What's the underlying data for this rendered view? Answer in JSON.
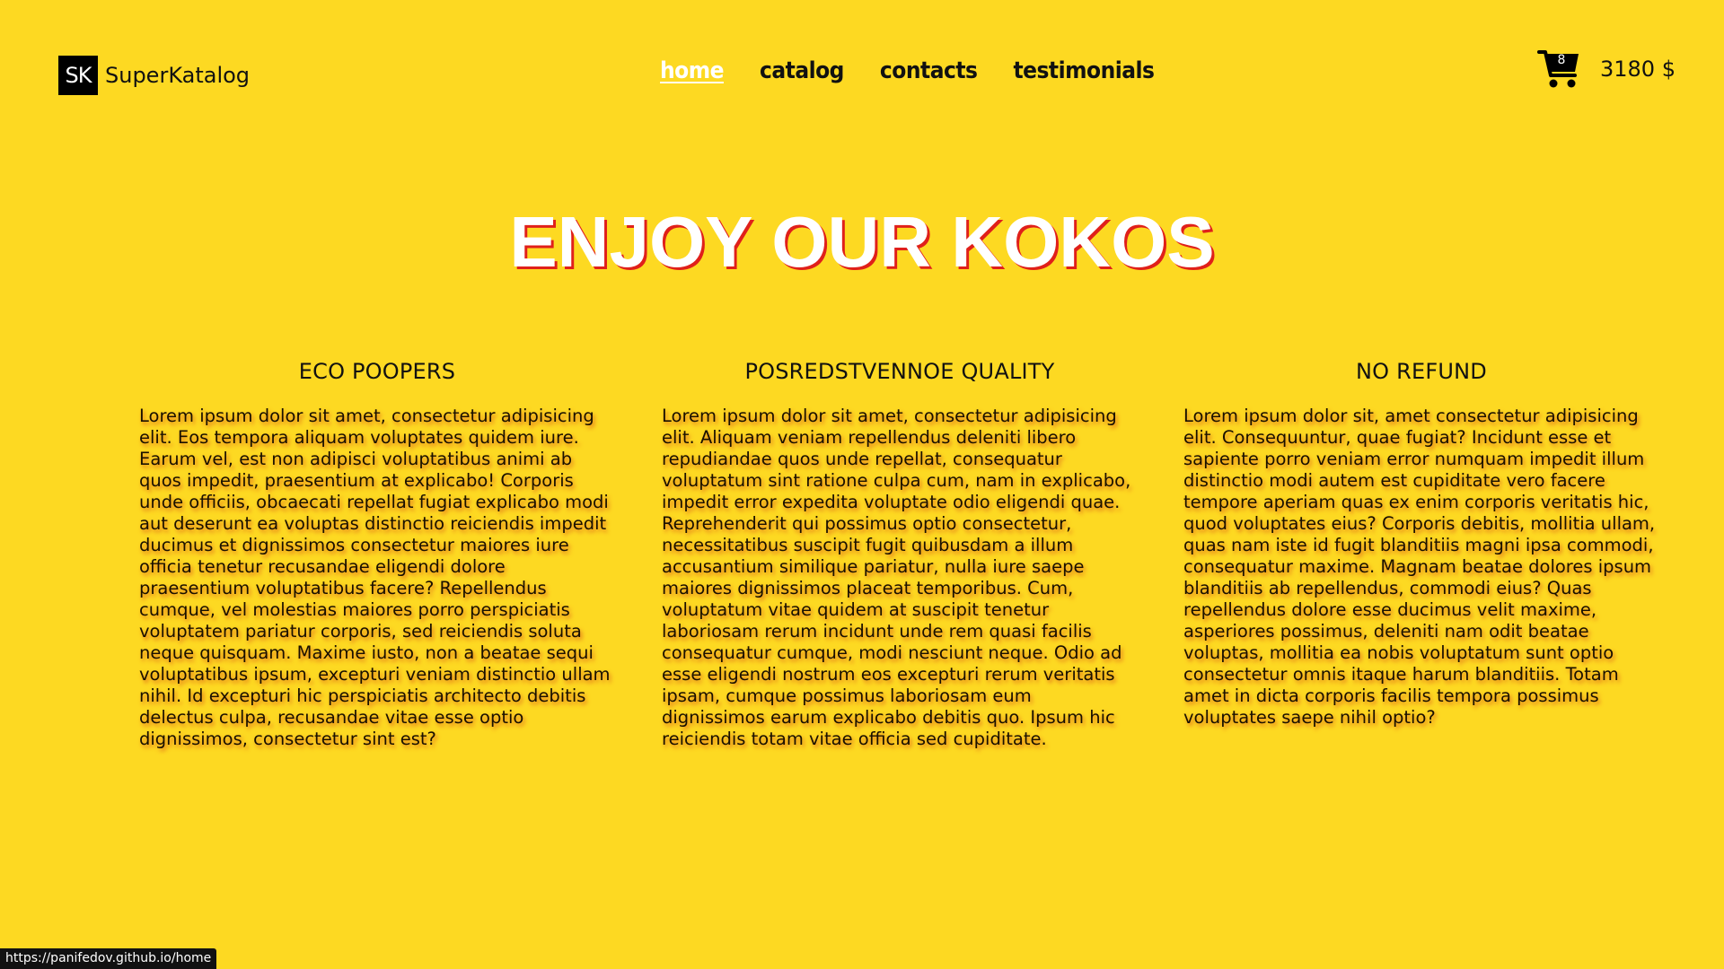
{
  "header": {
    "logo_mark": "SK",
    "logo_name": "SuperKatalog",
    "nav": [
      {
        "label": "home",
        "active": true
      },
      {
        "label": "catalog",
        "active": false
      },
      {
        "label": "contacts",
        "active": false
      },
      {
        "label": "testimonials",
        "active": false
      }
    ],
    "cart": {
      "icon": "cart-icon",
      "count": "8",
      "total": "3180 $"
    }
  },
  "hero": {
    "title": "ENJOY OUR KOKOS"
  },
  "features": [
    {
      "title": "ECO POOPERS",
      "text": "Lorem ipsum dolor sit amet, consectetur adipisicing elit. Eos tempora aliquam voluptates quidem iure. Earum vel, est non adipisci voluptatibus animi ab quos impedit, praesentium at explicabo! Corporis unde officiis, obcaecati repellat fugiat explicabo modi aut deserunt ea voluptas distinctio reiciendis impedit ducimus et dignissimos consectetur maiores iure officia tenetur recusandae eligendi dolore praesentium voluptatibus facere? Repellendus cumque, vel molestias maiores porro perspiciatis voluptatem pariatur corporis, sed reiciendis soluta neque quisquam. Maxime iusto, non a beatae sequi voluptatibus ipsum, excepturi veniam distinctio ullam nihil. Id excepturi hic perspiciatis architecto debitis delectus culpa, recusandae vitae esse optio dignissimos, consectetur sint est?"
    },
    {
      "title": "POSREDSTVENNOE QUALITY",
      "text": "Lorem ipsum dolor sit amet, consectetur adipisicing elit. Aliquam veniam repellendus deleniti libero repudiandae quos unde repellat, consequatur voluptatum sint ratione culpa cum, nam in explicabo, impedit error expedita voluptate odio eligendi quae. Reprehenderit qui possimus optio consectetur, necessitatibus suscipit fugit quibusdam a illum accusantium similique pariatur, nulla iure saepe maiores dignissimos placeat temporibus. Cum, voluptatum vitae quidem at suscipit tenetur laboriosam rerum incidunt unde rem quasi facilis consequatur cumque, modi nesciunt neque. Odio ad esse eligendi nostrum eos excepturi rerum veritatis ipsam, cumque possimus laboriosam eum dignissimos earum explicabo debitis quo. Ipsum hic reiciendis totam vitae officia sed cupiditate."
    },
    {
      "title": "NO REFUND",
      "text": "Lorem ipsum dolor sit, amet consectetur adipisicing elit. Consequuntur, quae fugiat? Incidunt esse et sapiente porro veniam error numquam impedit illum distinctio modi autem est cupiditate vero facere tempore aperiam quas ex enim corporis veritatis hic, quod voluptates eius? Corporis debitis, mollitia ullam, quas nam iste id fugit blanditiis magni ipsa commodi, consequatur maxime. Magnam beatae dolores ipsum blanditiis ab repellendus, commodi eius? Quas repellendus dolore esse ducimus velit maxime, asperiores possimus, deleniti nam odit beatae voluptas, mollitia ea nobis voluptatum sunt optio consectetur omnis itaque harum blanditiis. Totam amet in dicta corporis facilis tempora possimus voluptates saepe nihil optio?"
    }
  ],
  "status_bar": {
    "url": "https://panifedov.github.io/home"
  }
}
